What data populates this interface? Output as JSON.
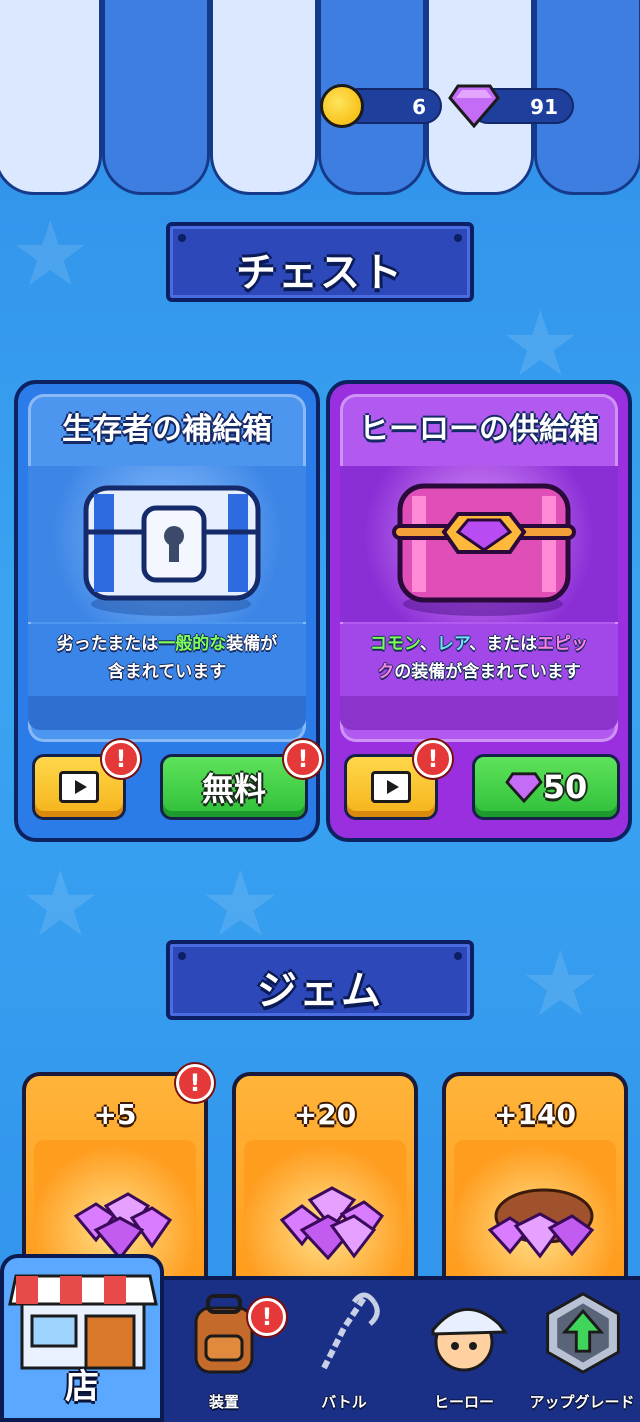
{
  "currency": {
    "coins": "6",
    "gems": "91"
  },
  "sections": {
    "chests_title": "チェスト",
    "gems_title": "ジェム"
  },
  "chests": [
    {
      "title": "生存者の補給箱",
      "desc_line1_a": "劣ったまたは",
      "desc_line1_b": "一般的な",
      "desc_line1_c": "装備が",
      "desc_line2": "含まれています",
      "video_badge": "!",
      "buy_label": "無料",
      "buy_badge": "!"
    },
    {
      "title": "ヒーローの供給箱",
      "desc_line1_a": "コモン",
      "desc_line1_b": "、",
      "desc_line1_c": "レア",
      "desc_line1_d": "、または",
      "desc_line1_e": "エピッ",
      "desc_line2_a": "ク",
      "desc_line2_b": "の装備が含まれています",
      "video_badge": "!",
      "buy_label": "50"
    }
  ],
  "gem_packs": [
    {
      "label": "+5",
      "badge": "!"
    },
    {
      "label": "+20"
    },
    {
      "label": "+140"
    }
  ],
  "nav": {
    "shop": "店",
    "equipment": "装置",
    "equipment_badge": "!",
    "battle": "バトル",
    "hero": "ヒーロー",
    "upgrade": "アップグレード"
  },
  "colors": {
    "accent_green": "#7dff5a",
    "accent_blue": "#6fe1ff",
    "accent_pink": "#ff82e8"
  }
}
